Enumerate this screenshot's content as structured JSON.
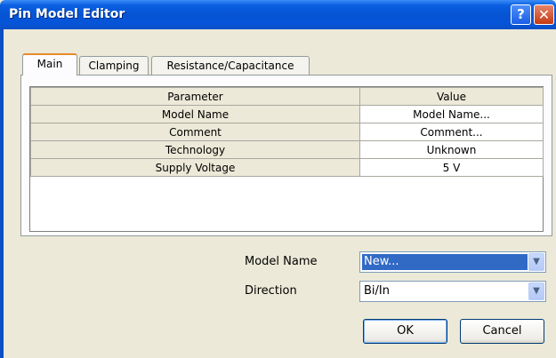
{
  "window": {
    "title": "Pin Model Editor",
    "help_glyph": "?",
    "close_glyph": "✕"
  },
  "tabs": [
    {
      "label": "Main"
    },
    {
      "label": "Clamping"
    },
    {
      "label": "Resistance/Capacitance"
    }
  ],
  "table": {
    "headers": [
      "Parameter",
      "Value"
    ],
    "rows": [
      {
        "parameter": "Model Name",
        "value": "Model Name..."
      },
      {
        "parameter": "Comment",
        "value": "Comment..."
      },
      {
        "parameter": "Technology",
        "value": "Unknown"
      },
      {
        "parameter": "Supply Voltage",
        "value": "5 V"
      }
    ]
  },
  "form": {
    "model_name_label": "Model Name",
    "model_name_value": "New...",
    "direction_label": "Direction",
    "direction_value": "Bi/In",
    "dropdown_glyph": "▼"
  },
  "buttons": {
    "ok": "OK",
    "cancel": "Cancel"
  }
}
